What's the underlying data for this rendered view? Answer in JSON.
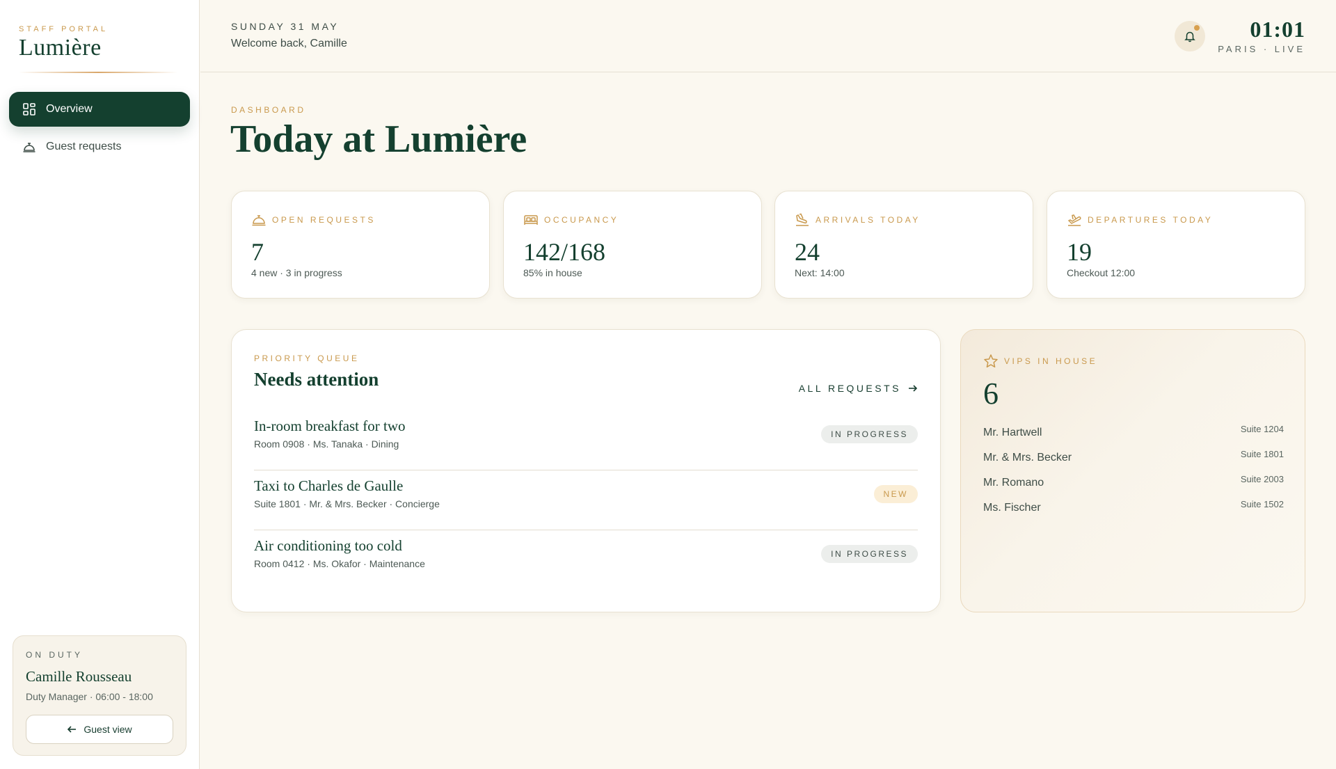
{
  "brand": {
    "kicker": "STAFF PORTAL",
    "name": "Lumière"
  },
  "nav": [
    {
      "label": "Overview",
      "icon": "grid-icon",
      "active": true
    },
    {
      "label": "Guest requests",
      "icon": "service-bell-icon",
      "active": false
    }
  ],
  "duty": {
    "kicker": "ON DUTY",
    "name": "Camille Rousseau",
    "role": "Duty Manager · 06:00 - 18:00",
    "button_label": "Guest view"
  },
  "header": {
    "date": "SUNDAY 31 MAY",
    "welcome": "Welcome back, Camille",
    "time": "01:01",
    "location": "PARIS · LIVE"
  },
  "page": {
    "kicker": "DASHBOARD",
    "title": "Today at Lumière"
  },
  "stats": [
    {
      "label": "OPEN REQUESTS",
      "value": "7",
      "sub": "4 new · 3 in progress",
      "icon": "service-bell-icon"
    },
    {
      "label": "OCCUPANCY",
      "value": "142/168",
      "sub": "85% in house",
      "icon": "bed-icon"
    },
    {
      "label": "ARRIVALS TODAY",
      "value": "24",
      "sub": "Next: 14:00",
      "icon": "plane-landing-icon"
    },
    {
      "label": "DEPARTURES TODAY",
      "value": "19",
      "sub": "Checkout 12:00",
      "icon": "plane-takeoff-icon"
    }
  ],
  "queue": {
    "kicker": "PRIORITY QUEUE",
    "title": "Needs attention",
    "link_label": "ALL REQUESTS",
    "requests": [
      {
        "title": "In-room breakfast for two",
        "meta": "Room 0908 · Ms. Tanaka · Dining",
        "status": "IN PROGRESS"
      },
      {
        "title": "Taxi to Charles de Gaulle",
        "meta": "Suite 1801 · Mr. & Mrs. Becker · Concierge",
        "status": "NEW"
      },
      {
        "title": "Air conditioning too cold",
        "meta": "Room 0412 · Ms. Okafor · Maintenance",
        "status": "IN PROGRESS"
      }
    ]
  },
  "vips": {
    "label": "VIPS IN HOUSE",
    "count": "6",
    "guests": [
      {
        "name": "Mr. Hartwell",
        "suite": "Suite 1204"
      },
      {
        "name": "Mr. & Mrs. Becker",
        "suite": "Suite 1801"
      },
      {
        "name": "Mr. Romano",
        "suite": "Suite 2003"
      },
      {
        "name": "Ms. Fischer",
        "suite": "Suite 1502"
      }
    ]
  },
  "colors": {
    "brand_green": "#14402f",
    "gold_accent": "#c9994d",
    "background": "#fbf8f0",
    "notification_dot": "#d8a04f"
  }
}
